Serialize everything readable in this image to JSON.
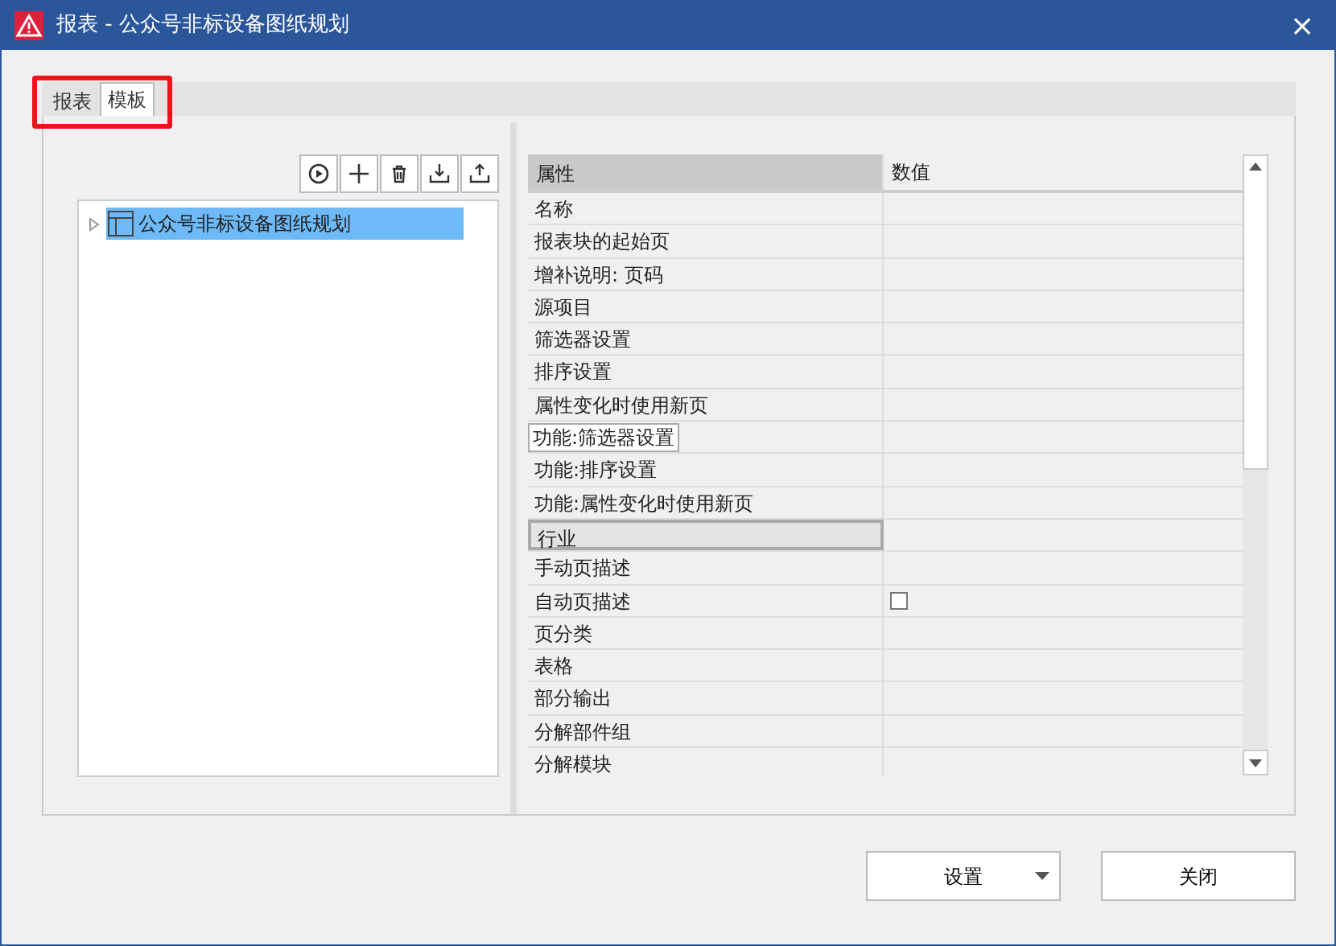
{
  "window": {
    "title": "报表 - 公众号非标设备图纸规划",
    "close": "×"
  },
  "tabs_highlighted": true,
  "tabs": [
    {
      "label": "报表",
      "selected": false
    },
    {
      "label": "模板",
      "selected": true
    }
  ],
  "tree": {
    "items": [
      {
        "label": "公众号非标设备图纸规划",
        "selected": true,
        "expanded": false
      }
    ]
  },
  "grid": {
    "columns": [
      "属性",
      "数值"
    ],
    "rows": [
      {
        "label": "名称",
        "selected": false
      },
      {
        "label": "报表块的起始页",
        "selected": false
      },
      {
        "label": "增补说明: 页码",
        "selected": false
      },
      {
        "label": "源项目",
        "selected": false
      },
      {
        "label": "筛选器设置",
        "selected": false
      },
      {
        "label": "排序设置",
        "selected": false
      },
      {
        "label": "属性变化时使用新页",
        "selected": false
      },
      {
        "tooltip": "功能:筛选器设置",
        "selected": false
      },
      {
        "label": "功能:排序设置",
        "selected": false
      },
      {
        "label": "功能:属性变化时使用新页",
        "selected": false
      },
      {
        "label": "行业",
        "selected": true
      },
      {
        "label": "手动页描述",
        "selected": false
      },
      {
        "label": "自动页描述",
        "selected": false,
        "kind": "checkbox",
        "checked": false
      },
      {
        "label": "页分类",
        "selected": false
      },
      {
        "label": "表格",
        "selected": false
      },
      {
        "label": "部分输出",
        "selected": false
      },
      {
        "label": "分解部件组",
        "selected": false
      },
      {
        "label": "分解模块",
        "selected": false
      }
    ]
  },
  "buttons": [
    {
      "label": "设置",
      "kind": "dropdown"
    },
    {
      "label": "关闭",
      "kind": "plain"
    }
  ]
}
